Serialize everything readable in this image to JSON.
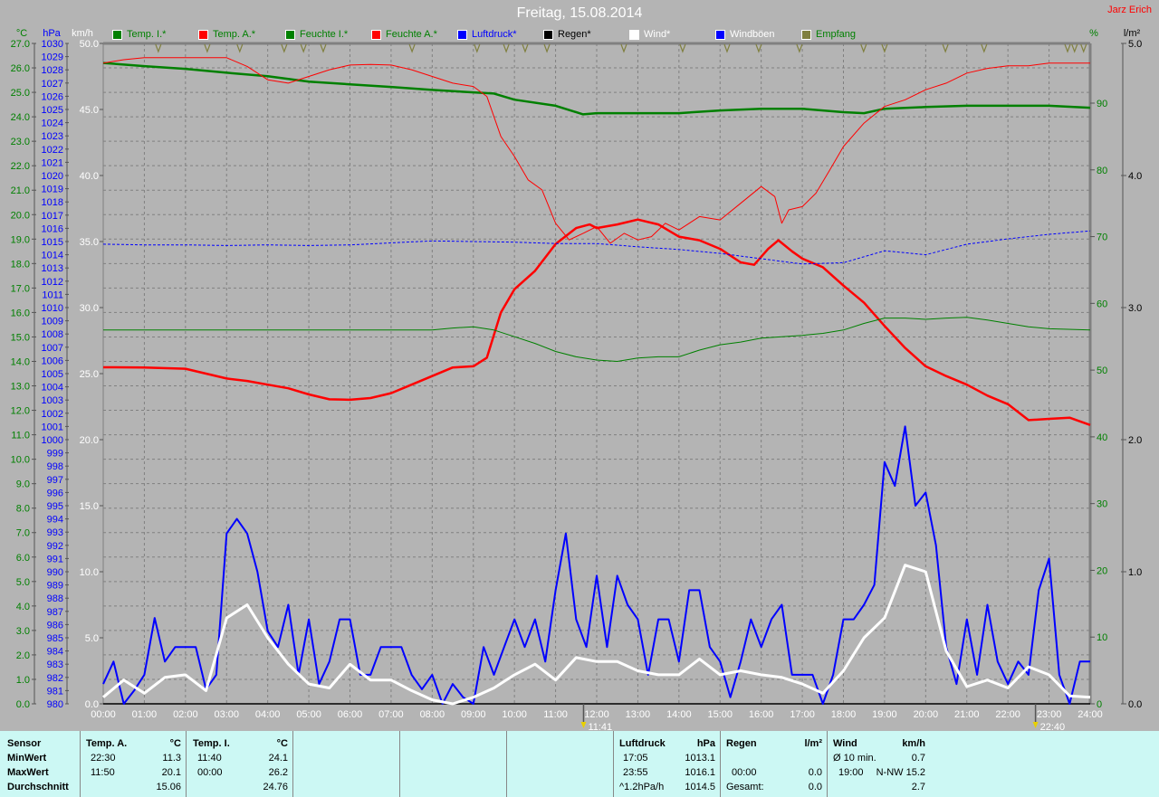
{
  "title": "Freitag, 15.08.2014",
  "author": "Jarz Erich",
  "legend": [
    {
      "label": "Temp. I.*",
      "box": "#008000",
      "text_color": "#008000"
    },
    {
      "label": "Temp. A.*",
      "box": "#ff0000",
      "text_color": "#008000"
    },
    {
      "label": "Feuchte I.*",
      "box": "#008000",
      "text_color": "#008000"
    },
    {
      "label": "Feuchte A.*",
      "box": "#ff0000",
      "text_color": "#008000"
    },
    {
      "label": "Luftdruck*",
      "box": "#0000ff",
      "text_color": "#0000ff"
    },
    {
      "label": "Regen*",
      "box": "#000000",
      "text_color": "#000000"
    },
    {
      "label": "Wind*",
      "box": "#ffffff",
      "text_color": "#ffffff"
    },
    {
      "label": "Windböen",
      "box": "#0000ff",
      "text_color": "#ffffff"
    },
    {
      "label": "Empfang",
      "box": "#808040",
      "text_color": "#008000"
    }
  ],
  "chart_data": {
    "type": "line",
    "title": "Freitag, 15.08.2014",
    "xlabel": "",
    "x_range_hours": [
      0,
      24
    ],
    "x_ticks": [
      "00:00",
      "01:00",
      "02:00",
      "03:00",
      "04:00",
      "05:00",
      "06:00",
      "07:00",
      "08:00",
      "09:00",
      "10:00",
      "11:00",
      "12:00",
      "13:00",
      "14:00",
      "15:00",
      "16:00",
      "17:00",
      "18:00",
      "19:00",
      "20:00",
      "21:00",
      "22:00",
      "23:00",
      "24:00"
    ],
    "grid": true,
    "axes": {
      "temp": {
        "unit": "°C",
        "range": [
          0,
          27
        ],
        "step": 1,
        "color": "#008000",
        "side": "left"
      },
      "pressure": {
        "unit": "hPa",
        "range": [
          980,
          1030
        ],
        "step": 1,
        "color": "#0000ff",
        "side": "left"
      },
      "speed": {
        "unit": "km/h",
        "range": [
          0,
          50
        ],
        "step": 5,
        "color": "#ffffff",
        "side": "left"
      },
      "humidity": {
        "unit": "%",
        "range": [
          0,
          90
        ],
        "step": 10,
        "color": "#008000",
        "side": "right"
      },
      "rain": {
        "unit": "l/m²",
        "range": [
          0,
          5
        ],
        "step": 1,
        "color": "#000000",
        "side": "right"
      }
    },
    "series": [
      {
        "name": "Temp. I.",
        "axis": "temp",
        "color": "#008000",
        "width": 2.5,
        "x": [
          0,
          1,
          2,
          3,
          4,
          5,
          6,
          7,
          8,
          9,
          9.5,
          10,
          11,
          11.67,
          12,
          13,
          14,
          15,
          16,
          17,
          18,
          18.5,
          19,
          20,
          21,
          22,
          23,
          24
        ],
        "y": [
          26.2,
          26.07,
          25.96,
          25.8,
          25.66,
          25.44,
          25.33,
          25.22,
          25.1,
          25.0,
          24.95,
          24.7,
          24.45,
          24.1,
          24.15,
          24.15,
          24.15,
          24.26,
          24.33,
          24.33,
          24.19,
          24.15,
          24.33,
          24.4,
          24.45,
          24.45,
          24.45,
          24.37
        ]
      },
      {
        "name": "Temp. A.",
        "axis": "temp",
        "color": "#ff0000",
        "width": 2.5,
        "x": [
          0,
          1,
          2,
          3,
          3.5,
          4,
          4.5,
          5,
          5.5,
          6,
          6.5,
          7,
          7.5,
          8,
          8.5,
          9,
          9.33,
          9.67,
          10,
          10.5,
          11,
          11.5,
          11.83,
          12,
          12.5,
          13,
          13.5,
          14,
          14.5,
          15,
          15.5,
          15.83,
          16.17,
          16.42,
          16.75,
          17,
          17.5,
          18,
          18.5,
          19,
          19.5,
          20,
          20.5,
          21,
          21.5,
          22,
          22.5,
          23,
          23.5,
          24
        ],
        "y": [
          13.76,
          13.75,
          13.7,
          13.3,
          13.2,
          13.05,
          12.9,
          12.65,
          12.45,
          12.43,
          12.5,
          12.7,
          13.05,
          13.4,
          13.75,
          13.8,
          14.15,
          16.0,
          16.95,
          17.7,
          18.8,
          19.45,
          19.6,
          19.45,
          19.6,
          19.8,
          19.6,
          19.1,
          18.95,
          18.6,
          18.05,
          17.95,
          18.6,
          18.95,
          18.5,
          18.2,
          17.85,
          17.1,
          16.4,
          15.45,
          14.55,
          13.8,
          13.4,
          13.05,
          12.6,
          12.25,
          11.6,
          11.65,
          11.7,
          11.4
        ]
      },
      {
        "name": "Feuchte I.",
        "axis": "humidity",
        "color": "#008000",
        "width": 1,
        "x": [
          0,
          8,
          8.5,
          9,
          9.5,
          10,
          10.5,
          11,
          11.5,
          12,
          12.5,
          13,
          13.5,
          14,
          14.5,
          15,
          15.5,
          16,
          16.5,
          17,
          17.5,
          18,
          18.5,
          19,
          19.5,
          20,
          20.5,
          21,
          21.5,
          22,
          22.5,
          23,
          24
        ],
        "y": [
          56.0,
          56.0,
          56.3,
          56.5,
          56.0,
          55.0,
          54.0,
          52.8,
          52.0,
          51.5,
          51.3,
          51.8,
          52.0,
          52.0,
          53.0,
          53.8,
          54.2,
          54.8,
          55.0,
          55.2,
          55.5,
          56.0,
          57.0,
          57.8,
          57.8,
          57.6,
          57.8,
          57.9,
          57.5,
          57.0,
          56.5,
          56.2,
          56.0
        ]
      },
      {
        "name": "Feuchte A.",
        "axis": "humidity",
        "color": "#ff0000",
        "width": 1,
        "x": [
          0,
          0.5,
          1,
          1.5,
          2,
          2.5,
          3,
          3.5,
          4,
          4.5,
          5,
          5.5,
          6,
          6.5,
          7,
          7.5,
          8,
          8.5,
          9,
          9.33,
          9.67,
          10,
          10.33,
          10.67,
          11,
          11.33,
          11.67,
          12,
          12.33,
          12.67,
          13,
          13.33,
          13.67,
          14,
          14.5,
          15,
          15.5,
          16,
          16.33,
          16.5,
          16.67,
          17,
          17.33,
          17.67,
          18,
          18.5,
          19,
          19.5,
          20,
          20.5,
          21,
          21.5,
          22,
          22.5,
          23,
          23.5,
          24
        ],
        "y": [
          96.0,
          96.5,
          96.8,
          96.8,
          96.8,
          96.8,
          96.8,
          95.5,
          93.5,
          93.0,
          94.0,
          95.0,
          95.7,
          95.8,
          95.7,
          95.0,
          94.0,
          93.0,
          92.5,
          91.0,
          85.0,
          82.0,
          78.5,
          77.0,
          72.0,
          69.5,
          70.5,
          71.5,
          69.0,
          70.5,
          69.5,
          70.0,
          72.0,
          71.0,
          73.0,
          72.5,
          75.0,
          77.5,
          76.0,
          72.0,
          74.0,
          74.5,
          76.5,
          80.0,
          83.5,
          87.0,
          89.5,
          90.5,
          92.0,
          93.0,
          94.5,
          95.2,
          95.6,
          95.6,
          96.0,
          96.0,
          96.0
        ]
      },
      {
        "name": "Luftdruck",
        "axis": "pressure",
        "color": "#0000ff",
        "width": 1,
        "dashed": true,
        "x": [
          0,
          1,
          2,
          3,
          4,
          5,
          6,
          7,
          8,
          9,
          10,
          11,
          12,
          13,
          14,
          15,
          16,
          17,
          18,
          19,
          20,
          21,
          22,
          23,
          24
        ],
        "y": [
          1014.8,
          1014.75,
          1014.75,
          1014.7,
          1014.75,
          1014.7,
          1014.75,
          1014.9,
          1015.05,
          1015.0,
          1014.95,
          1014.85,
          1014.85,
          1014.6,
          1014.4,
          1014.1,
          1013.7,
          1013.3,
          1013.4,
          1014.3,
          1014.0,
          1014.8,
          1015.2,
          1015.55,
          1015.8
        ]
      },
      {
        "name": "Regen",
        "axis": "rain",
        "color": "#000000",
        "width": 1,
        "x": [
          0,
          24
        ],
        "y": [
          0,
          0
        ]
      },
      {
        "name": "Windböen",
        "axis": "speed",
        "color": "#0000ff",
        "width": 2,
        "x_step_hours": 0.25,
        "y": [
          1.5,
          3.2,
          0.0,
          1.0,
          2.2,
          6.5,
          3.2,
          4.3,
          4.3,
          4.3,
          1.1,
          2.2,
          12.9,
          14.0,
          12.9,
          10.0,
          5.5,
          4.3,
          7.5,
          2.2,
          6.4,
          1.5,
          3.2,
          6.4,
          6.4,
          2.2,
          2.2,
          4.3,
          4.3,
          4.3,
          2.2,
          1.1,
          2.2,
          0.0,
          1.5,
          0.5,
          0.0,
          4.3,
          2.2,
          4.3,
          6.4,
          4.3,
          6.4,
          3.2,
          8.6,
          12.9,
          6.4,
          4.3,
          9.7,
          4.3,
          9.7,
          7.5,
          6.4,
          2.2,
          6.4,
          6.4,
          3.2,
          8.6,
          8.6,
          4.3,
          3.2,
          0.5,
          3.2,
          6.4,
          4.3,
          6.4,
          7.5,
          2.2,
          2.2,
          2.2,
          0.0,
          2.2,
          6.4,
          6.4,
          7.5,
          9.0,
          18.3,
          16.5,
          21.0,
          15.0,
          16.0,
          12.0,
          4.3,
          1.5,
          6.4,
          2.2,
          7.5,
          3.2,
          1.5,
          3.2,
          2.2,
          8.6,
          11.0,
          2.2,
          0.0,
          3.2,
          3.2
        ]
      },
      {
        "name": "Wind",
        "axis": "speed",
        "color": "#ffffff",
        "width": 3,
        "x_step_hours": 0.5,
        "y": [
          0.5,
          1.8,
          0.8,
          2.0,
          2.2,
          1.0,
          6.5,
          7.5,
          5.0,
          3.0,
          1.5,
          1.2,
          3.0,
          1.8,
          1.8,
          1.0,
          0.3,
          0.0,
          0.5,
          1.2,
          2.2,
          3.0,
          1.8,
          3.5,
          3.2,
          3.2,
          2.5,
          2.2,
          2.2,
          3.4,
          2.2,
          2.5,
          2.2,
          2.0,
          1.5,
          0.8,
          2.5,
          5.0,
          6.5,
          10.5,
          10.0,
          4.0,
          1.3,
          1.8,
          1.2,
          2.8,
          2.2,
          0.6,
          0.5
        ]
      },
      {
        "name": "Empfang",
        "color": "#808040",
        "dips_at_hours": [
          1.34,
          2.53,
          3.32,
          4.4,
          4.87,
          5.35,
          7.51,
          9.09,
          9.8,
          10.26,
          10.79,
          12.66,
          14.09,
          15.17,
          15.94,
          16.93,
          18.49,
          19.0,
          20.48,
          21.42,
          23.45,
          23.62,
          23.84
        ]
      }
    ],
    "markers": [
      {
        "label": "11:41",
        "hour": 11.68
      },
      {
        "label": "22:40",
        "hour": 22.67
      }
    ]
  },
  "table": {
    "sensor": {
      "header": "Sensor",
      "rows": [
        "MinWert",
        "MaxWert",
        "Durchschnitt"
      ]
    },
    "temp_a": {
      "header": "Temp. A.",
      "unit": "°C",
      "rows": [
        [
          "22:30",
          "11.3"
        ],
        [
          "11:50",
          "20.1"
        ],
        [
          "",
          "15.06"
        ]
      ]
    },
    "temp_i": {
      "header": "Temp. I.",
      "unit": "°C",
      "rows": [
        [
          "11:40",
          "24.1"
        ],
        [
          "00:00",
          "26.2"
        ],
        [
          "",
          "24.76"
        ]
      ]
    },
    "pressure": {
      "header": "Luftdruck",
      "unit": "hPa",
      "rows": [
        [
          "17:05",
          "1013.1"
        ],
        [
          "23:55",
          "1016.1"
        ],
        [
          "^1.2hPa/h",
          "1014.5"
        ]
      ]
    },
    "rain": {
      "header": "Regen",
      "unit": "l/m²",
      "rows": [
        [
          "",
          ""
        ],
        [
          "00:00",
          "0.0"
        ],
        [
          "Gesamt:",
          "0.0"
        ]
      ]
    },
    "wind": {
      "header": "Wind",
      "unit": "km/h",
      "rows": [
        [
          "Ø 10 min.",
          "0.7"
        ],
        [
          "19:00",
          "N-NW 15.2"
        ],
        [
          "",
          "2.7"
        ]
      ]
    }
  }
}
